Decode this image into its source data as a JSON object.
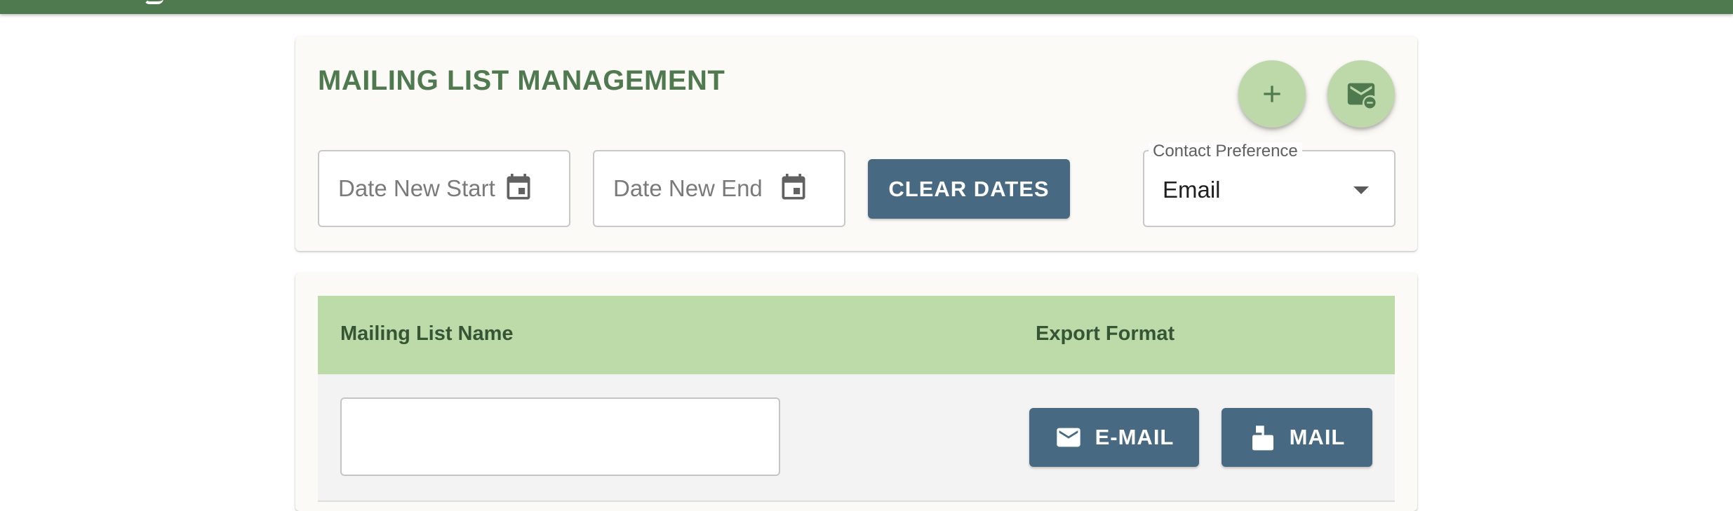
{
  "colors": {
    "header_bar": "#4f7a4f",
    "title": "#4f7a4f",
    "fab_background": "#bdd9a9",
    "button_primary": "#476a82",
    "table_header": "#bddba9"
  },
  "filters": {
    "title": "MAILING LIST MANAGEMENT",
    "date_start_placeholder": "Date New Start",
    "date_end_placeholder": "Date New End",
    "date_icon": "calendar-icon",
    "clear_label": "CLEAR DATES",
    "contact_preference": {
      "label": "Contact Preference",
      "value": "Email"
    },
    "actions": [
      {
        "icon": "plus-icon"
      },
      {
        "icon": "mail-remove-icon"
      }
    ]
  },
  "table": {
    "columns": [
      "Mailing List Name",
      "Export Format"
    ],
    "rows": [
      {
        "name_value": "",
        "exports": [
          {
            "label": "E-MAIL",
            "icon": "envelope-icon"
          },
          {
            "label": "MAIL",
            "icon": "mailbox-icon"
          }
        ]
      }
    ]
  }
}
